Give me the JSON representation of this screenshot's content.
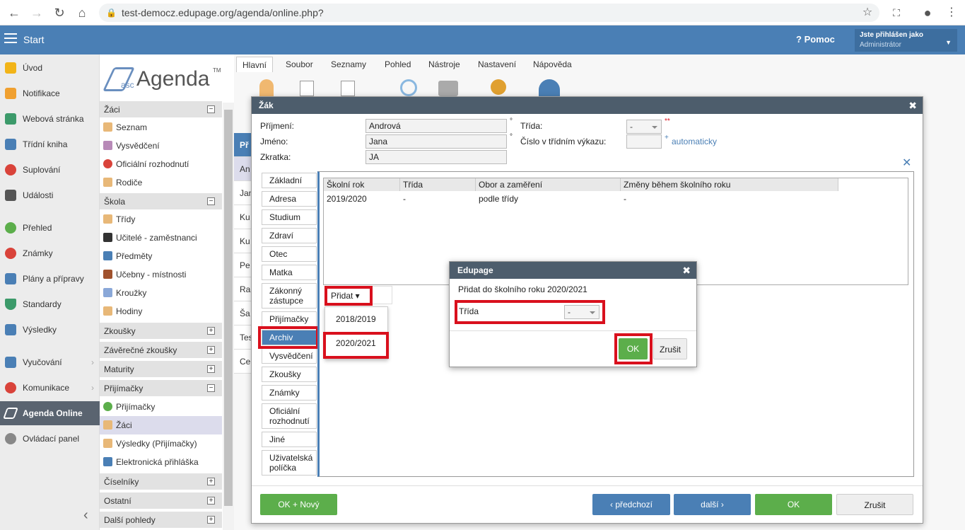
{
  "browser": {
    "url": "test-democz.edupage.org/agenda/online.php?"
  },
  "header": {
    "start": "Start",
    "help": "Pomoc",
    "user_line1": "Jste přihlášen jako",
    "user_line2": "Administrátor"
  },
  "leftnav": [
    {
      "label": "Úvod",
      "color": "#f2b418"
    },
    {
      "label": "Notifikace",
      "color": "#f0a030"
    },
    {
      "label": "Webová stránka",
      "color": "#3c9a6a"
    },
    {
      "label": "Třídní kniha",
      "color": "#4a7fb5"
    },
    {
      "label": "Suplování",
      "color": "#d9433a"
    },
    {
      "label": "Události",
      "color": "#555555"
    },
    {
      "label": "Přehled",
      "color": "#5cae4b"
    },
    {
      "label": "Známky",
      "color": "#d9433a"
    },
    {
      "label": "Plány a přípravy",
      "color": "#4a7fb5"
    },
    {
      "label": "Standardy",
      "color": "#3c9a6a"
    },
    {
      "label": "Výsledky",
      "color": "#4a7fb5"
    },
    {
      "label": "Vyučování",
      "color": "#4a7fb5"
    },
    {
      "label": "Komunikace",
      "color": "#d9433a"
    },
    {
      "label": "Agenda Online",
      "color": "#ffffff"
    },
    {
      "label": "Ovládací panel",
      "color": "#888888"
    }
  ],
  "logo": {
    "asc": "asc",
    "agenda": "Agenda",
    "tm": "TM"
  },
  "sidebar": {
    "zaci": "Žáci",
    "seznam": "Seznam",
    "vysvedceni": "Vysvědčení",
    "oficialni": "Oficiální rozhodnutí",
    "rodice": "Rodiče",
    "skola": "Škola",
    "tridy": "Třídy",
    "ucitele": "Učitelé - zaměstnanci",
    "predmety": "Předměty",
    "ucebny": "Učebny - místnosti",
    "krouzky": "Kroužky",
    "hodiny": "Hodiny",
    "zkousky": "Zkoušky",
    "zaverecne": "Závěrečné zkoušky",
    "maturity": "Maturity",
    "prijimacky": "Přijímačky",
    "prijimacky_item": "Přijímačky",
    "zaci_item": "Žáci",
    "vysledky": "Výsledky (Přijímačky)",
    "elektronicka": "Elektronická přihláška",
    "ciselniky": "Číselníky",
    "ostatni": "Ostatní",
    "dalsi": "Další pohledy",
    "minus": "⊟",
    "plus": "⊞"
  },
  "menutabs": [
    "Hlavní",
    "Soubor",
    "Seznamy",
    "Pohled",
    "Nástroje",
    "Nastavení",
    "Nápověda"
  ],
  "bg_rows": [
    "Př",
    "An",
    "Jan",
    "Ku",
    "Ku",
    "Pe",
    "Ra",
    "Ša",
    "Tes",
    "Ce"
  ],
  "dialog": {
    "title": "Žák",
    "prijmeni_label": "Příjmení:",
    "prijmeni": "Andrová",
    "jmeno_label": "Jméno:",
    "jmeno": "Jana",
    "zkratka_label": "Zkratka:",
    "zkratka": "JA",
    "trida_label": "Třída:",
    "trida_value": "-",
    "req": "**",
    "cislo_label": "Číslo v třídním výkazu:",
    "automaticky": "automaticky",
    "plus": "+",
    "deg": "°",
    "tabs": [
      "Základní",
      "Adresa",
      "Studium",
      "Zdraví",
      "Otec",
      "Matka",
      "Zákonný zástupce",
      "Přijímačky",
      "Archiv",
      "Vysvědčení",
      "Zkoušky",
      "Známky",
      "Oficiální rozhodnutí",
      "Jiné",
      "Uživatelská políčka"
    ],
    "table": {
      "headers": [
        "Školní rok",
        "Třída",
        "Obor a zaměření",
        "Změny během školního roku"
      ],
      "row": [
        "2019/2020",
        "-",
        "podle třídy",
        "-"
      ]
    },
    "pridat": "Přidat ▾",
    "years": [
      "2018/2019",
      "2020/2021"
    ],
    "buttons": {
      "ok_novy": "OK + Nový",
      "predchozi": "předchozí",
      "dalsi": "další",
      "ok": "OK",
      "zrusit": "Zrušit"
    },
    "close": "✖"
  },
  "edupage": {
    "title": "Edupage",
    "close": "✖",
    "text": "Přidat do školního roku 2020/2021",
    "trida_label": "Třída",
    "trida_value": "-",
    "ok": "OK",
    "zrusit": "Zrušit"
  }
}
